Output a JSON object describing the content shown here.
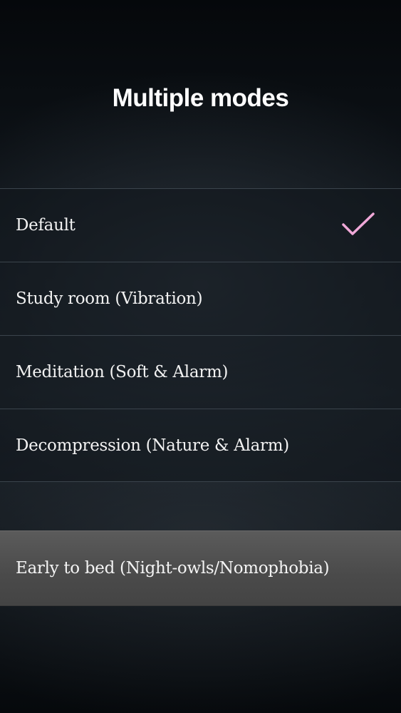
{
  "header": {
    "title": "Multiple modes"
  },
  "modes": [
    {
      "label": "Default",
      "selected": true,
      "check_icon": "checkmark-icon"
    },
    {
      "label": "Study room (Vibration)",
      "selected": false
    },
    {
      "label": "Meditation (Soft & Alarm)",
      "selected": false
    },
    {
      "label": "Decompression (Nature & Alarm)",
      "selected": false
    }
  ],
  "highlighted_mode": {
    "label": "Early to bed (Night-owls/Nomophobia)"
  },
  "colors": {
    "check": "#f0a8d8",
    "highlight_bg": "#555555",
    "background": "#121920"
  }
}
